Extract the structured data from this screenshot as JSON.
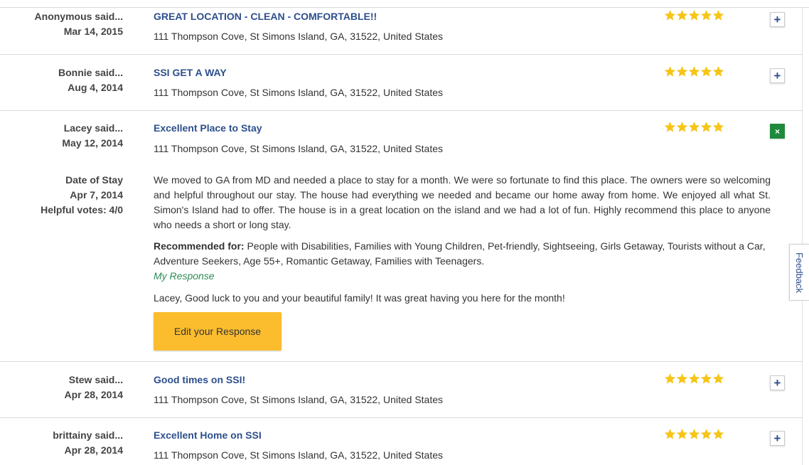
{
  "reviews": [
    {
      "author": "Anonymous said...",
      "date": "Mar 14, 2015",
      "title": "GREAT LOCATION - CLEAN - COMFORTABLE!!",
      "address": "111 Thompson Cove, St Simons Island, GA, 31522, United States",
      "rating": 5,
      "toggle": "+"
    },
    {
      "author": "Bonnie said...",
      "date": "Aug 4, 2014",
      "title": "SSI GET A WAY",
      "address": "111 Thompson Cove, St Simons Island, GA, 31522, United States",
      "rating": 5,
      "toggle": "+"
    },
    {
      "author": "Lacey said...",
      "date": "May 12, 2014",
      "title": "Excellent Place to Stay",
      "address": "111 Thompson Cove, St Simons Island, GA, 31522, United States",
      "rating": 5,
      "toggle": "×",
      "date_of_stay_label": "Date of Stay",
      "date_of_stay": "Apr 7, 2014",
      "helpful_votes": "Helpful votes: 4/0",
      "body": "We moved to GA from MD and needed a place to stay for a month. We were so fortunate to find this place. The owners were so welcoming and helpful throughout our stay. The house had everything we needed and became our home away from home. We enjoyed all what St. Simon's Island had to offer. The house is in a great location on the island and we had a lot of fun. Highly recommend this place to anyone who needs a short or long stay.",
      "recommended_label": "Recommended for:",
      "recommended": " People with Disabilities, Families with Young Children, Pet-friendly, Sightseeing, Girls Getaway, Tourists without a Car, Adventure Seekers, Age 55+, Romantic Getaway, Families with Teenagers.",
      "response_label": "My Response",
      "response": "Lacey, Good luck to you and your beautiful family! It was great having you here for the month!",
      "edit_button": "Edit your Response"
    },
    {
      "author": "Stew said...",
      "date": "Apr 28, 2014",
      "title": "Good times on SSI!",
      "address": "111 Thompson Cove, St Simons Island, GA, 31522, United States",
      "rating": 5,
      "toggle": "+"
    },
    {
      "author": "brittainy said...",
      "date": "Apr 28, 2014",
      "title": "Excellent Home on SSI",
      "address": "111 Thompson Cove, St Simons Island, GA, 31522, United States",
      "rating": 5,
      "toggle": "+"
    }
  ],
  "feedback_tab": "Feedback",
  "colors": {
    "title": "#2d4f8c",
    "star": "#f5c518",
    "response_label": "#2e8b57",
    "button": "#fbbd2e",
    "close_toggle": "#1f8a3c"
  }
}
